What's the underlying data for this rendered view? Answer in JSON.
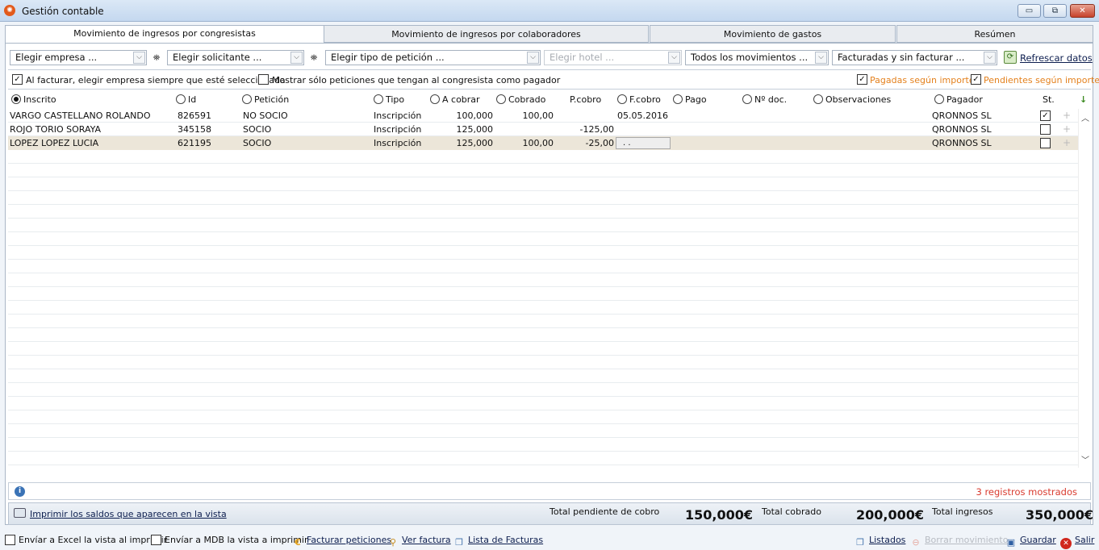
{
  "window": {
    "title": "Gestión contable",
    "btn_min": "▭",
    "btn_max": "⧉",
    "btn_close": "✕"
  },
  "tabs": [
    {
      "label": "Movimiento de ingresos por congresistas",
      "active": true
    },
    {
      "label": "Movimiento de ingresos por colaboradores",
      "active": false
    },
    {
      "label": "Movimiento de gastos",
      "active": false
    },
    {
      "label": "Resúmen",
      "active": false
    }
  ],
  "filters": {
    "empresa": "Elegir empresa ...",
    "solicitante": "Elegir solicitante ...",
    "tipo_peticion": "Elegir tipo de petición ...",
    "hotel": "Elegir hotel ...",
    "movimientos": "Todos los movimientos ...",
    "facturadas": "Facturadas y sin facturar ...",
    "refresh_label": "Refrescar datos"
  },
  "options": {
    "elegir_empresa": {
      "label": "Al facturar, elegir empresa siempre que esté seleccionada",
      "checked": true
    },
    "mostrar_solo": {
      "label": "Mostrar sólo peticiones que tengan al congresista como pagador",
      "checked": false
    },
    "pagadas": {
      "label": "Pagadas según importe",
      "checked": true
    },
    "pendientes": {
      "label": "Pendientes según importe",
      "checked": true
    }
  },
  "columns": {
    "inscrito": "Inscrito",
    "id": "Id",
    "peticion": "Petición",
    "tipo": "Tipo",
    "a_cobrar": "A cobrar",
    "cobrado": "Cobrado",
    "p_cobro": "P.cobro",
    "f_cobro": "F.cobro",
    "pago": "Pago",
    "n_doc": "Nº doc.",
    "observaciones": "Observaciones",
    "pagador": "Pagador",
    "st": "St."
  },
  "rows": [
    {
      "inscrito": "VARGO CASTELLANO ROLANDO",
      "id": "826591",
      "peticion": "NO SOCIO",
      "tipo": "Inscripción",
      "a_cobrar": "100,000",
      "cobrado": "100,00",
      "p_cobro": "",
      "f_cobro": "05.05.2016",
      "pagador": "QRONNOS SL",
      "st": true
    },
    {
      "inscrito": "ROJO TORIO SORAYA",
      "id": "345158",
      "peticion": "SOCIO",
      "tipo": "Inscripción",
      "a_cobrar": "125,000",
      "cobrado": "",
      "p_cobro": "-125,00",
      "f_cobro": "",
      "pagador": "QRONNOS SL",
      "st": false
    },
    {
      "inscrito": "LOPEZ LOPEZ LUCIA",
      "id": "621195",
      "peticion": "SOCIO",
      "tipo": "Inscripción",
      "a_cobrar": "125,000",
      "cobrado": "100,00",
      "p_cobro": "-25,00",
      "f_cobro": ". .",
      "pagador": "QRONNOS SL",
      "st": false
    }
  ],
  "status": {
    "records": "3 registros mostrados"
  },
  "totals": {
    "print_label": "Imprimir los saldos que aparecen en la vista",
    "pendiente_label": "Total pendiente de cobro",
    "pendiente_value": "150,000€",
    "cobrado_label": "Total cobrado",
    "cobrado_value": "200,000€",
    "ingresos_label": "Total ingresos",
    "ingresos_value": "350,000€"
  },
  "footer": {
    "excel": "Envíar a Excel la vista al imprimir",
    "mdb": "Envíar a MDB la vista a imprimir",
    "facturar": "Facturar peticiones",
    "ver_factura": "Ver factura",
    "lista_facturas": "Lista de Facturas",
    "listados": "Listados",
    "borrar": "Borrar movimiento",
    "guardar": "Guardar",
    "salir": "Salir"
  },
  "colors": {
    "accent_orange": "#e4811d",
    "records_red": "#d93b2f",
    "selected_row": "#ece6d9"
  }
}
